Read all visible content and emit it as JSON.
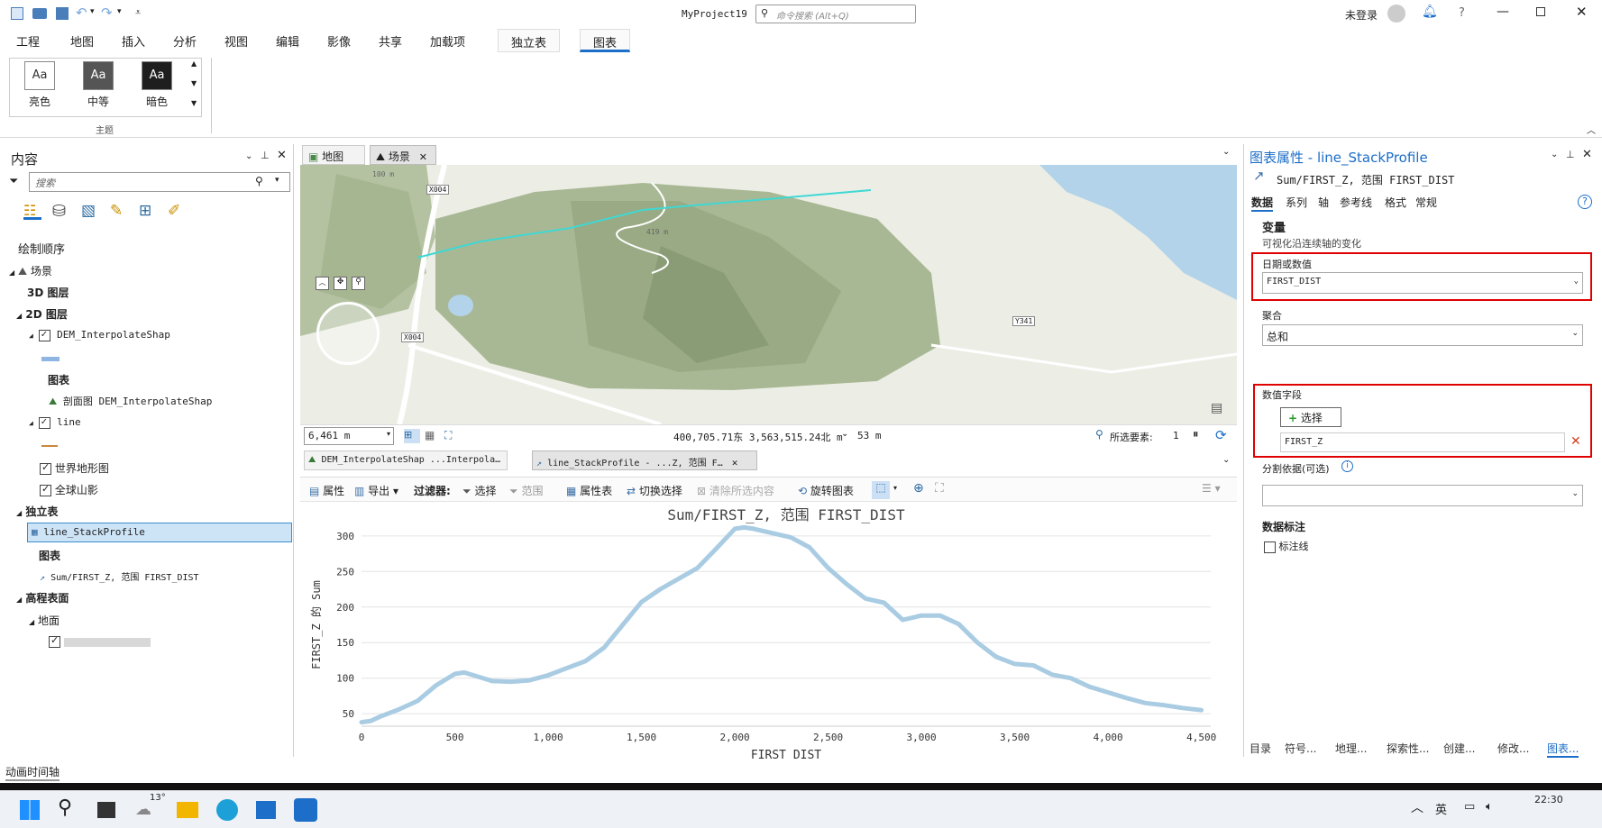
{
  "titlebar": {
    "project": "MyProject19",
    "search_placeholder": "命令搜索 (Alt+Q)",
    "user": "未登录"
  },
  "ribbon_tabs": [
    "工程",
    "地图",
    "插入",
    "分析",
    "视图",
    "编辑",
    "影像",
    "共享",
    "加载项"
  ],
  "context_tabs": {
    "standalone": "独立表",
    "chart": "图表"
  },
  "themes": {
    "items": [
      "亮色",
      "中等",
      "暗色"
    ],
    "swatch": "Aa",
    "group_label": "主题"
  },
  "contents": {
    "title": "内容",
    "search_placeholder": "搜索",
    "drawing_order": "绘制顺序",
    "scene": "场景",
    "layers3d": "3D 图层",
    "layers2d": "2D 图层",
    "dem": "DEM_InterpolateShap",
    "charts_label": "图表",
    "profile_chart": "剖面图 DEM_InterpolateShap",
    "line": "line",
    "world_topo": "世界地形图",
    "global_hillshade": "全球山影",
    "standalone_tables": "独立表",
    "stack_profile": "line_StackProfile",
    "sum_chart": "Sum/FIRST_Z, 范围 FIRST_DIST",
    "elevation_surfaces": "高程表面",
    "ground": "地面"
  },
  "view_tabs": {
    "map": "地图",
    "scene": "场景"
  },
  "map": {
    "scale": "6,461 m",
    "coords": "400,705.71东 3,563,515.24北 m",
    "elevation": "53 m",
    "selected_label": "所选要素:",
    "selected_count": "1",
    "labels": [
      "X004",
      "X004",
      "Y341",
      "419 m",
      "100 m"
    ]
  },
  "chart_tabs": {
    "profile": "DEM_InterpolateShap ...Interpola…",
    "stack": "line_StackProfile - ...Z, 范围 F…"
  },
  "chart_toolbar": {
    "properties": "属性",
    "export": "导出",
    "filter": "过滤器:",
    "select": "选择",
    "extent": "范围",
    "attr_table": "属性表",
    "switch_sel": "切换选择",
    "clear_sel": "清除所选内容",
    "rotate": "旋转图表"
  },
  "chart_data": {
    "type": "line",
    "title": "Sum/FIRST_Z, 范围 FIRST_DIST",
    "xlabel": "FIRST_DIST",
    "ylabel": "FIRST_Z 的 Sum",
    "xlim": [
      0,
      4550
    ],
    "ylim": [
      35,
      315
    ],
    "xticks": [
      0,
      500,
      1000,
      1500,
      2000,
      2500,
      3000,
      3500,
      4000,
      4500
    ],
    "xtick_labels": [
      "0",
      "500",
      "1,000",
      "1,500",
      "2,000",
      "2,500",
      "3,000",
      "3,500",
      "4,000",
      "4,500"
    ],
    "yticks": [
      50,
      100,
      150,
      200,
      250,
      300
    ],
    "grid": true,
    "color": "#a9cce3",
    "x": [
      0,
      50,
      100,
      200,
      300,
      400,
      500,
      550,
      600,
      700,
      800,
      900,
      1000,
      1100,
      1200,
      1300,
      1400,
      1500,
      1600,
      1700,
      1800,
      1900,
      2000,
      2050,
      2100,
      2200,
      2300,
      2400,
      2500,
      2600,
      2700,
      2800,
      2900,
      3000,
      3100,
      3200,
      3300,
      3400,
      3500,
      3600,
      3700,
      3800,
      3900,
      4000,
      4100,
      4200,
      4300,
      4400,
      4500
    ],
    "y": [
      38,
      40,
      46,
      56,
      68,
      90,
      106,
      108,
      104,
      96,
      95,
      97,
      104,
      114,
      124,
      143,
      175,
      207,
      225,
      240,
      255,
      282,
      310,
      312,
      310,
      304,
      298,
      284,
      255,
      232,
      212,
      206,
      182,
      188,
      188,
      176,
      150,
      130,
      120,
      118,
      105,
      100,
      88,
      80,
      72,
      65,
      62,
      58,
      55
    ]
  },
  "props": {
    "title": "图表属性 - line_StackProfile",
    "subtitle": "Sum/FIRST_Z, 范围 FIRST_DIST",
    "tabs": [
      "数据",
      "系列",
      "轴",
      "参考线",
      "格式",
      "常规"
    ],
    "variables": "变量",
    "variables_desc": "可视化沿连续轴的变化",
    "date_or_number": "日期或数值",
    "date_field": "FIRST_DIST",
    "aggregation": "聚合",
    "aggregation_value": "总和",
    "numeric_fields": "数值字段",
    "select_btn": "选择",
    "numeric_field_value": "FIRST_Z",
    "split_by": "分割依据(可选)",
    "data_labels": "数据标注",
    "label_columns": "标注线"
  },
  "bottom_tabs": [
    "目录",
    "符号...",
    "地理...",
    "探索性...",
    "创建...",
    "修改...",
    "图表..."
  ],
  "status": {
    "animation": "动画时间轴"
  },
  "taskbar": {
    "temp": "13°",
    "time": "22:30",
    "lang": "英"
  }
}
